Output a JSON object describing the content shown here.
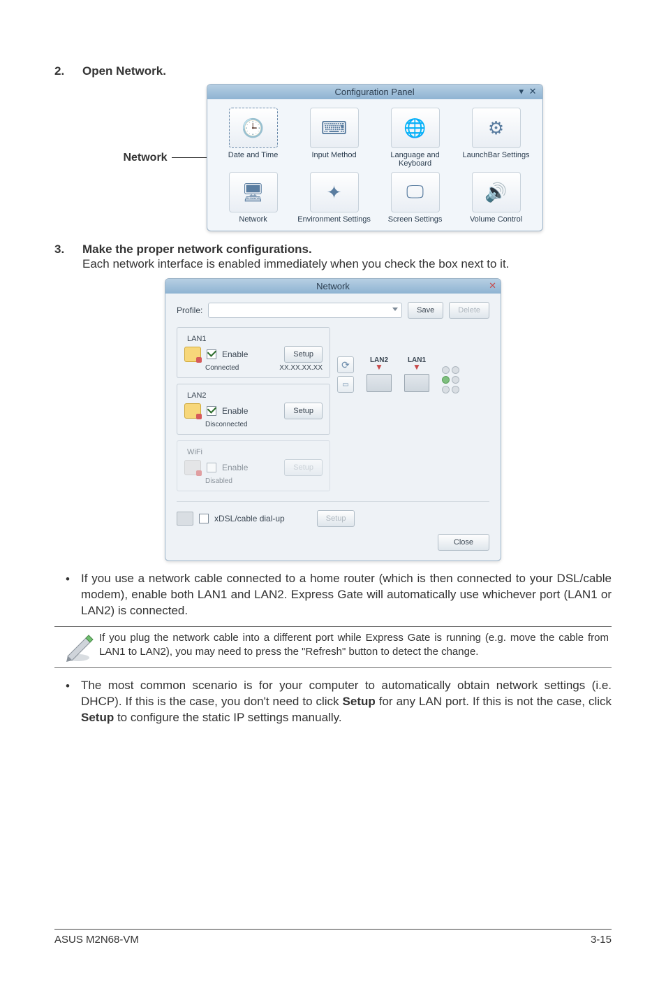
{
  "step2": {
    "num": "2.",
    "title": "Open Network."
  },
  "conf": {
    "label_left": "Network",
    "title": "Configuration Panel",
    "cells": [
      {
        "caption": "Date and Time",
        "glyph": "🕒",
        "selected": true
      },
      {
        "caption": "Input Method",
        "glyph": "⌨",
        "selected": false
      },
      {
        "caption": "Language and Keyboard",
        "glyph": "🌐",
        "selected": false
      },
      {
        "caption": "LaunchBar Settings",
        "glyph": "⚙",
        "selected": false
      },
      {
        "caption": "Network",
        "glyph": "🖥",
        "selected": false
      },
      {
        "caption": "Environment Settings",
        "glyph": "✦",
        "selected": false
      },
      {
        "caption": "Screen Settings",
        "glyph": "🖵",
        "selected": false
      },
      {
        "caption": "Volume Control",
        "glyph": "🔊",
        "selected": false
      }
    ]
  },
  "step3": {
    "num": "3.",
    "title": "Make the proper network configurations.",
    "text": "Each network interface is enabled immediately when you check the box next to it."
  },
  "net": {
    "title": "Network",
    "profile_label": "Profile:",
    "save": "Save",
    "delete": "Delete",
    "lan1": {
      "legend": "LAN1",
      "enable": "Enable",
      "setup": "Setup",
      "status": "Connected",
      "ip": "XX.XX.XX.XX"
    },
    "lan2": {
      "legend": "LAN2",
      "enable": "Enable",
      "setup": "Setup",
      "status": "Disconnected"
    },
    "wifi": {
      "legend": "WiFi",
      "enable": "Enable",
      "setup": "Setup",
      "status": "Disabled"
    },
    "ports": {
      "lan2": "LAN2",
      "lan1": "LAN1"
    },
    "xdsl": {
      "label": "xDSL/cable dial-up",
      "setup": "Setup"
    },
    "close": "Close"
  },
  "bullet1": "If you use a network cable connected to a home router (which is then connected to your DSL/cable modem), enable both LAN1 and LAN2. Express Gate  will automatically use whichever port (LAN1 or LAN2) is connected.",
  "note": "If you plug the network cable into a different port while Express Gate  is running (e.g. move the cable from LAN1 to LAN2), you may need to press the \"Refresh\" button to detect the change.",
  "bullet2_a": "The most common scenario is for your computer to automatically obtain network settings (i.e. DHCP). If this is the case, you don't need to click ",
  "bullet2_b": "Setup",
  "bullet2_c": " for any LAN port. If this is not the case, click ",
  "bullet2_d": "Setup",
  "bullet2_e": " to configure the static IP settings manually.",
  "footer": {
    "left": "ASUS M2N68-VM",
    "right": "3-15"
  }
}
